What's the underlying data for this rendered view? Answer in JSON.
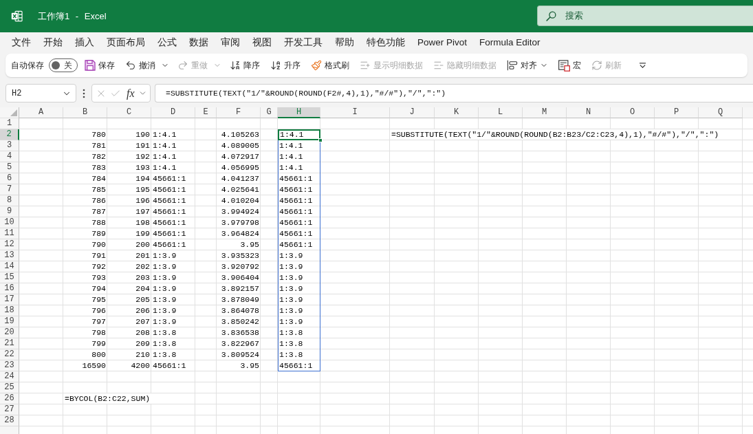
{
  "window": {
    "title": "工作簿1 - Excel",
    "search": {
      "placeholder": "搜索"
    }
  },
  "menu": [
    {
      "label": "文件",
      "selected": false
    },
    {
      "label": "开始",
      "selected": false
    },
    {
      "label": "插入",
      "selected": false
    },
    {
      "label": "页面布局",
      "selected": false
    },
    {
      "label": "公式",
      "selected": false
    },
    {
      "label": "数据",
      "selected": false
    },
    {
      "label": "审阅",
      "selected": false
    },
    {
      "label": "视图",
      "selected": false
    },
    {
      "label": "开发工具",
      "selected": false
    },
    {
      "label": "帮助",
      "selected": false
    },
    {
      "label": "特色功能",
      "selected": false
    },
    {
      "label": "Power Pivot",
      "selected": false
    },
    {
      "label": "Formula Editor",
      "selected": false
    }
  ],
  "toolbar": {
    "items": [
      {
        "kind": "toggle",
        "label": "自动保存",
        "state_text": "关",
        "on": false
      },
      {
        "kind": "button",
        "label": "保存",
        "disabled": false
      },
      {
        "kind": "split",
        "label": "撤消",
        "disabled": false
      },
      {
        "kind": "split",
        "label": "重做",
        "disabled": true
      },
      {
        "kind": "button",
        "label": "降序",
        "disabled": false
      },
      {
        "kind": "button",
        "label": "升序",
        "disabled": false
      },
      {
        "kind": "button",
        "label": "格式刷",
        "disabled": false
      },
      {
        "kind": "button",
        "label": "显示明细数据",
        "disabled": true
      },
      {
        "kind": "button",
        "label": "隐藏明细数据",
        "disabled": true
      },
      {
        "kind": "menu",
        "label": "对齐",
        "disabled": false
      },
      {
        "kind": "button",
        "label": "宏",
        "disabled": false
      },
      {
        "kind": "button",
        "label": "刷新",
        "disabled": true
      },
      {
        "kind": "overflow",
        "disabled": false
      }
    ]
  },
  "formula_bar": {
    "name_box": "H2",
    "function_label": "fx",
    "formula": "=SUBSTITUTE(TEXT(\"1/\"&ROUND(ROUND(F2#,4),1),\"#/#\"),\"/\",\":\")"
  },
  "sheet": {
    "columns": [
      {
        "label": "A",
        "selected": false
      },
      {
        "label": "B",
        "selected": false
      },
      {
        "label": "C",
        "selected": false
      },
      {
        "label": "D",
        "selected": false
      },
      {
        "label": "E",
        "selected": false
      },
      {
        "label": "F",
        "selected": false
      },
      {
        "label": "G",
        "selected": false
      },
      {
        "label": "H",
        "selected": true
      },
      {
        "label": "I",
        "selected": false
      },
      {
        "label": "J",
        "selected": false
      },
      {
        "label": "K",
        "selected": false
      },
      {
        "label": "L",
        "selected": false
      },
      {
        "label": "M",
        "selected": false
      },
      {
        "label": "N",
        "selected": false
      },
      {
        "label": "O",
        "selected": false
      },
      {
        "label": "P",
        "selected": false
      },
      {
        "label": "Q",
        "selected": false
      }
    ],
    "rows": [
      {
        "label": "1",
        "selected": false
      },
      {
        "label": "2",
        "selected": true,
        "cells": {
          "b": {
            "kind": "number",
            "text": "780"
          },
          "c": {
            "kind": "number",
            "text": "190"
          },
          "d": {
            "kind": "text",
            "text": "1:4.1"
          },
          "f": {
            "kind": "number",
            "text": "4.105263"
          },
          "h": {
            "kind": "spill",
            "text": "1:4.1"
          },
          "j": {
            "kind": "text",
            "text": "=SUBSTITUTE(TEXT(\"1/\"&ROUND(ROUND(B2:B23/C2:C23,4),1),\"#/#\"),\"/\",\":\")"
          }
        }
      },
      {
        "label": "3",
        "selected": false,
        "cells": {
          "b": {
            "kind": "number",
            "text": "781"
          },
          "c": {
            "kind": "number",
            "text": "191"
          },
          "d": {
            "kind": "text",
            "text": "1:4.1"
          },
          "f": {
            "kind": "number",
            "text": "4.089005"
          },
          "h": {
            "kind": "spill",
            "text": "1:4.1"
          }
        }
      },
      {
        "label": "4",
        "selected": false,
        "cells": {
          "b": {
            "kind": "number",
            "text": "782"
          },
          "c": {
            "kind": "number",
            "text": "192"
          },
          "d": {
            "kind": "text",
            "text": "1:4.1"
          },
          "f": {
            "kind": "number",
            "text": "4.072917"
          },
          "h": {
            "kind": "spill",
            "text": "1:4.1"
          }
        }
      },
      {
        "label": "5",
        "selected": false,
        "cells": {
          "b": {
            "kind": "number",
            "text": "783"
          },
          "c": {
            "kind": "number",
            "text": "193"
          },
          "d": {
            "kind": "text",
            "text": "1:4.1"
          },
          "f": {
            "kind": "number",
            "text": "4.056995"
          },
          "h": {
            "kind": "spill",
            "text": "1:4.1"
          }
        }
      },
      {
        "label": "6",
        "selected": false,
        "cells": {
          "b": {
            "kind": "number",
            "text": "784"
          },
          "c": {
            "kind": "number",
            "text": "194"
          },
          "d": {
            "kind": "text",
            "text": "45661:1"
          },
          "f": {
            "kind": "number",
            "text": "4.041237"
          },
          "h": {
            "kind": "spill",
            "text": "45661:1"
          }
        }
      },
      {
        "label": "7",
        "selected": false,
        "cells": {
          "b": {
            "kind": "number",
            "text": "785"
          },
          "c": {
            "kind": "number",
            "text": "195"
          },
          "d": {
            "kind": "text",
            "text": "45661:1"
          },
          "f": {
            "kind": "number",
            "text": "4.025641"
          },
          "h": {
            "kind": "spill",
            "text": "45661:1"
          }
        }
      },
      {
        "label": "8",
        "selected": false,
        "cells": {
          "b": {
            "kind": "number",
            "text": "786"
          },
          "c": {
            "kind": "number",
            "text": "196"
          },
          "d": {
            "kind": "text",
            "text": "45661:1"
          },
          "f": {
            "kind": "number",
            "text": "4.010204"
          },
          "h": {
            "kind": "spill",
            "text": "45661:1"
          }
        }
      },
      {
        "label": "9",
        "selected": false,
        "cells": {
          "b": {
            "kind": "number",
            "text": "787"
          },
          "c": {
            "kind": "number",
            "text": "197"
          },
          "d": {
            "kind": "text",
            "text": "45661:1"
          },
          "f": {
            "kind": "number",
            "text": "3.994924"
          },
          "h": {
            "kind": "spill",
            "text": "45661:1"
          }
        }
      },
      {
        "label": "10",
        "selected": false,
        "cells": {
          "b": {
            "kind": "number",
            "text": "788"
          },
          "c": {
            "kind": "number",
            "text": "198"
          },
          "d": {
            "kind": "text",
            "text": "45661:1"
          },
          "f": {
            "kind": "number",
            "text": "3.979798"
          },
          "h": {
            "kind": "spill",
            "text": "45661:1"
          }
        }
      },
      {
        "label": "11",
        "selected": false,
        "cells": {
          "b": {
            "kind": "number",
            "text": "789"
          },
          "c": {
            "kind": "number",
            "text": "199"
          },
          "d": {
            "kind": "text",
            "text": "45661:1"
          },
          "f": {
            "kind": "number",
            "text": "3.964824"
          },
          "h": {
            "kind": "spill",
            "text": "45661:1"
          }
        }
      },
      {
        "label": "12",
        "selected": false,
        "cells": {
          "b": {
            "kind": "number",
            "text": "790"
          },
          "c": {
            "kind": "number",
            "text": "200"
          },
          "d": {
            "kind": "text",
            "text": "45661:1"
          },
          "f": {
            "kind": "number",
            "text": "3.95"
          },
          "h": {
            "kind": "spill",
            "text": "45661:1"
          }
        }
      },
      {
        "label": "13",
        "selected": false,
        "cells": {
          "b": {
            "kind": "number",
            "text": "791"
          },
          "c": {
            "kind": "number",
            "text": "201"
          },
          "d": {
            "kind": "text",
            "text": "1:3.9"
          },
          "f": {
            "kind": "number",
            "text": "3.935323"
          },
          "h": {
            "kind": "spill",
            "text": "1:3.9"
          }
        }
      },
      {
        "label": "14",
        "selected": false,
        "cells": {
          "b": {
            "kind": "number",
            "text": "792"
          },
          "c": {
            "kind": "number",
            "text": "202"
          },
          "d": {
            "kind": "text",
            "text": "1:3.9"
          },
          "f": {
            "kind": "number",
            "text": "3.920792"
          },
          "h": {
            "kind": "spill",
            "text": "1:3.9"
          }
        }
      },
      {
        "label": "15",
        "selected": false,
        "cells": {
          "b": {
            "kind": "number",
            "text": "793"
          },
          "c": {
            "kind": "number",
            "text": "203"
          },
          "d": {
            "kind": "text",
            "text": "1:3.9"
          },
          "f": {
            "kind": "number",
            "text": "3.906404"
          },
          "h": {
            "kind": "spill",
            "text": "1:3.9"
          }
        }
      },
      {
        "label": "16",
        "selected": false,
        "cells": {
          "b": {
            "kind": "number",
            "text": "794"
          },
          "c": {
            "kind": "number",
            "text": "204"
          },
          "d": {
            "kind": "text",
            "text": "1:3.9"
          },
          "f": {
            "kind": "number",
            "text": "3.892157"
          },
          "h": {
            "kind": "spill",
            "text": "1:3.9"
          }
        }
      },
      {
        "label": "17",
        "selected": false,
        "cells": {
          "b": {
            "kind": "number",
            "text": "795"
          },
          "c": {
            "kind": "number",
            "text": "205"
          },
          "d": {
            "kind": "text",
            "text": "1:3.9"
          },
          "f": {
            "kind": "number",
            "text": "3.878049"
          },
          "h": {
            "kind": "spill",
            "text": "1:3.9"
          }
        }
      },
      {
        "label": "18",
        "selected": false,
        "cells": {
          "b": {
            "kind": "number",
            "text": "796"
          },
          "c": {
            "kind": "number",
            "text": "206"
          },
          "d": {
            "kind": "text",
            "text": "1:3.9"
          },
          "f": {
            "kind": "number",
            "text": "3.864078"
          },
          "h": {
            "kind": "spill",
            "text": "1:3.9"
          }
        }
      },
      {
        "label": "19",
        "selected": false,
        "cells": {
          "b": {
            "kind": "number",
            "text": "797"
          },
          "c": {
            "kind": "number",
            "text": "207"
          },
          "d": {
            "kind": "text",
            "text": "1:3.9"
          },
          "f": {
            "kind": "number",
            "text": "3.850242"
          },
          "h": {
            "kind": "spill",
            "text": "1:3.9"
          }
        }
      },
      {
        "label": "20",
        "selected": false,
        "cells": {
          "b": {
            "kind": "number",
            "text": "798"
          },
          "c": {
            "kind": "number",
            "text": "208"
          },
          "d": {
            "kind": "text",
            "text": "1:3.8"
          },
          "f": {
            "kind": "number",
            "text": "3.836538"
          },
          "h": {
            "kind": "spill",
            "text": "1:3.8"
          }
        }
      },
      {
        "label": "21",
        "selected": false,
        "cells": {
          "b": {
            "kind": "number",
            "text": "799"
          },
          "c": {
            "kind": "number",
            "text": "209"
          },
          "d": {
            "kind": "text",
            "text": "1:3.8"
          },
          "f": {
            "kind": "number",
            "text": "3.822967"
          },
          "h": {
            "kind": "spill",
            "text": "1:3.8"
          }
        }
      },
      {
        "label": "22",
        "selected": false,
        "cells": {
          "b": {
            "kind": "number",
            "text": "800"
          },
          "c": {
            "kind": "number",
            "text": "210"
          },
          "d": {
            "kind": "text",
            "text": "1:3.8"
          },
          "f": {
            "kind": "number",
            "text": "3.809524"
          },
          "h": {
            "kind": "spill",
            "text": "1:3.8"
          }
        }
      },
      {
        "label": "23",
        "selected": false,
        "cells": {
          "b": {
            "kind": "number",
            "text": "16590"
          },
          "c": {
            "kind": "number",
            "text": "4200"
          },
          "d": {
            "kind": "text",
            "text": "45661:1"
          },
          "f": {
            "kind": "number",
            "text": "3.95"
          },
          "h": {
            "kind": "spill",
            "text": "45661:1"
          }
        }
      },
      {
        "label": "24",
        "selected": false
      },
      {
        "label": "25",
        "selected": false
      },
      {
        "label": "26",
        "selected": false,
        "cells": {
          "b": {
            "kind": "text",
            "text": "=BYCOL(B2:C22,SUM)"
          }
        }
      },
      {
        "label": "27",
        "selected": false
      },
      {
        "label": "28",
        "selected": false
      }
    ]
  }
}
